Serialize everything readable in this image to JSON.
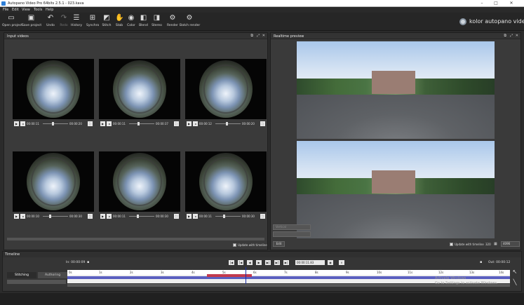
{
  "window": {
    "title": "Autopano Video Pro 64bits 2.5.1 - 023.kava",
    "minimize": "–",
    "maximize": "□",
    "close": "✕"
  },
  "menu": [
    "File",
    "Edit",
    "View",
    "Tools",
    "Help"
  ],
  "toolbar": [
    {
      "label": "Open project",
      "icon": "folder-icon",
      "glyph": "▭",
      "enabled": true
    },
    {
      "label": "Save project",
      "icon": "save-icon",
      "glyph": "▣",
      "enabled": true
    },
    {
      "label": "Undo",
      "icon": "undo-icon",
      "glyph": "↶",
      "enabled": true
    },
    {
      "label": "Redo",
      "icon": "redo-icon",
      "glyph": "↷",
      "enabled": false
    },
    {
      "label": "History",
      "icon": "history-icon",
      "glyph": "☰",
      "enabled": true
    },
    {
      "label": "Synchro",
      "icon": "clapper-icon",
      "glyph": "⊞",
      "enabled": true
    },
    {
      "label": "Stitch",
      "icon": "stitch-icon",
      "glyph": "◩",
      "enabled": true
    },
    {
      "label": "Stab",
      "icon": "hand-icon",
      "glyph": "✋",
      "enabled": true
    },
    {
      "label": "Color",
      "icon": "color-wheel-icon",
      "glyph": "◉",
      "enabled": true
    },
    {
      "label": "Blend",
      "icon": "blend-icon",
      "glyph": "◧",
      "enabled": true
    },
    {
      "label": "Stereo",
      "icon": "stereo-icon",
      "glyph": "◨",
      "enabled": true
    },
    {
      "label": "Render",
      "icon": "render-gear-icon",
      "glyph": "⚙",
      "enabled": true
    },
    {
      "label": "Batch render",
      "icon": "batch-gear-icon",
      "glyph": "⚙",
      "enabled": true
    }
  ],
  "brand": {
    "text": "kolor autopano video pro"
  },
  "input_panel": {
    "title": "Input videos",
    "update_label": "Update with timeline",
    "videos": [
      {
        "time_start": "00:00:11",
        "time_end": "00:00:20"
      },
      {
        "time_start": "00:00:11",
        "time_end": "00:00:37"
      },
      {
        "time_start": "00:00:12",
        "time_end": "00:00:20"
      },
      {
        "time_start": "00:00:10",
        "time_end": "00:00:30"
      },
      {
        "time_start": "00:00:11",
        "time_end": "00:00:30"
      },
      {
        "time_start": "00:00:11",
        "time_end": "00:00:30"
      }
    ]
  },
  "preview_panel": {
    "title": "Realtime preview",
    "field1": "Vertical",
    "field2": "",
    "edit_button": "Edit",
    "update_label": "Update with timeline",
    "resolution": "320",
    "zoom": "4096"
  },
  "timeline": {
    "title": "Timeline",
    "in_time": "In: 00:00:09",
    "out_time": "Out: 00:00:12",
    "current_time": "00:00:11.83",
    "tabs": [
      "Stitching",
      "Authoring"
    ],
    "ruler_labels": [
      "0s",
      "1s",
      "2s",
      "3s",
      "4s",
      "5s",
      "6s",
      "7s",
      "8s",
      "9s",
      "10s",
      "11s",
      "12s",
      "13s",
      "14s"
    ]
  },
  "watermark": [
    "Activate Windows",
    "Go to Settings to activate Windows."
  ]
}
